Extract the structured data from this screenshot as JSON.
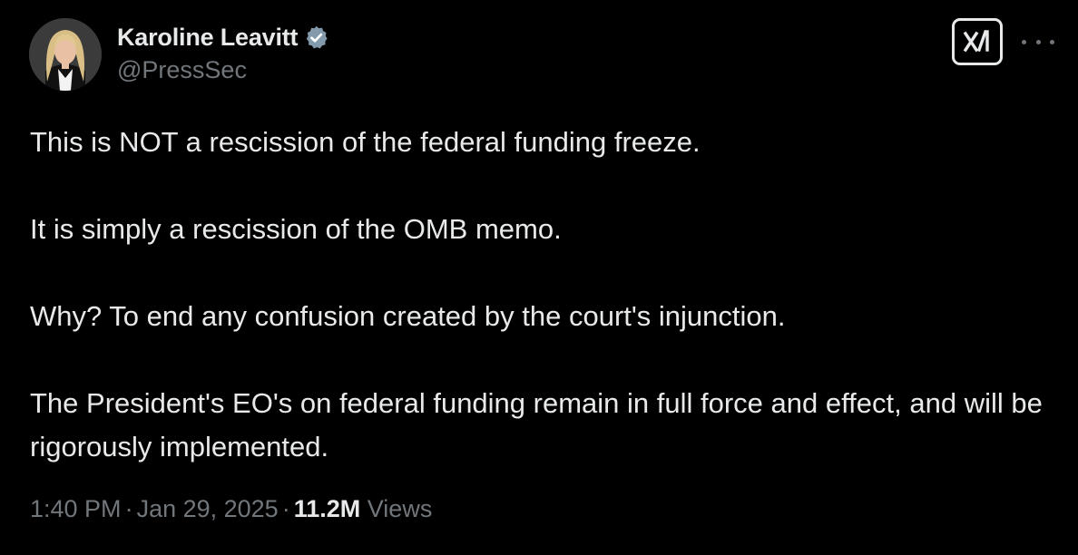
{
  "author": {
    "display_name": "Karoline Leavitt",
    "handle": "@PressSec",
    "verified": true,
    "verified_color": "#829aab"
  },
  "icons": {
    "avatar": "profile-photo",
    "verified": "verified-badge-icon",
    "grok": "grok-logo-icon",
    "more": "more-options-icon"
  },
  "post": {
    "paragraphs": [
      "This is NOT a rescission of the federal funding freeze.",
      "It is simply a rescission of the OMB memo.",
      "Why? To end any confusion created by the court's injunction.",
      "The President's EO's on federal funding remain in full force and effect, and will be rigorously implemented."
    ]
  },
  "meta": {
    "time": "1:40 PM",
    "separator": "·",
    "date": "Jan 29, 2025",
    "views_count": "11.2M",
    "views_label": "Views"
  },
  "colors": {
    "background": "#000000",
    "primary_text": "#e7e9ea",
    "secondary_text": "#71767b"
  }
}
